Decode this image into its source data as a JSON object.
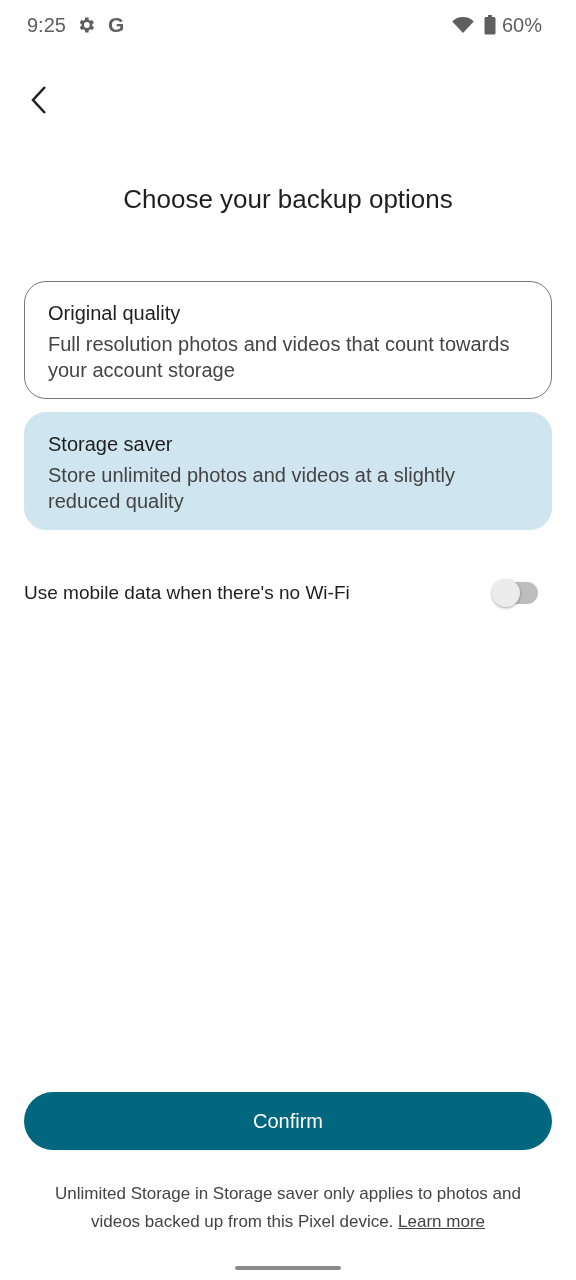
{
  "status_bar": {
    "time": "9:25",
    "google_mark": "G",
    "battery": "60%"
  },
  "title": "Choose your backup options",
  "options": [
    {
      "title": "Original quality",
      "description": "Full resolution photos and videos that count towards your account storage",
      "selected": false
    },
    {
      "title": "Storage saver",
      "description": "Store unlimited photos and videos at a slightly reduced quality",
      "selected": true
    }
  ],
  "mobile_data": {
    "label": "Use mobile data when there's no Wi-Fi",
    "on": false
  },
  "confirm_button": "Confirm",
  "footnote": {
    "text": "Unlimited Storage in Storage saver only applies to photos and videos backed up from this Pixel device.",
    "link": "Learn more"
  }
}
